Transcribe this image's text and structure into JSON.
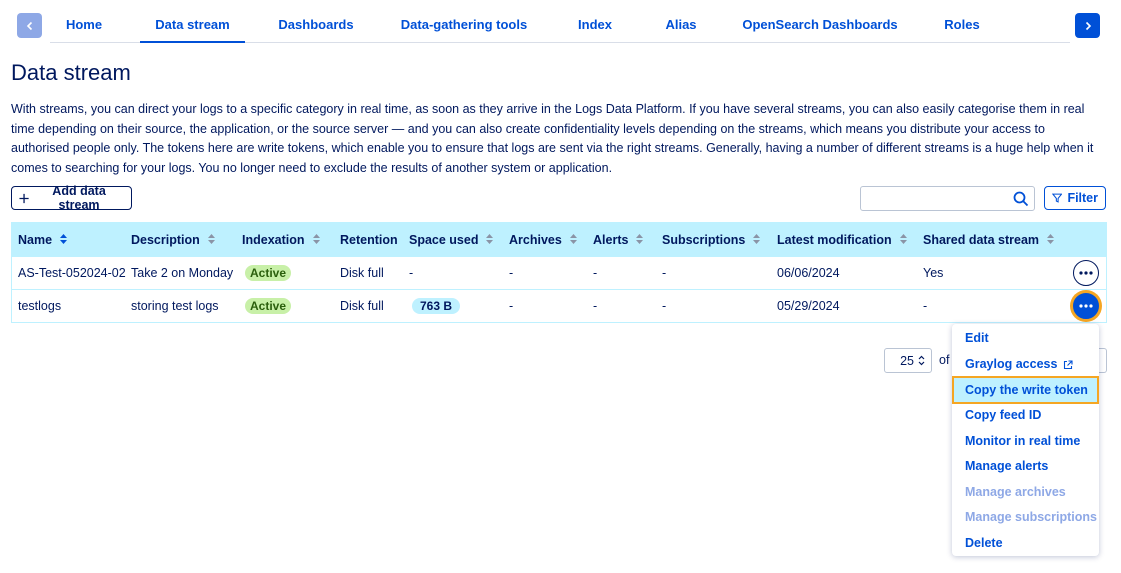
{
  "nav": {
    "tabs": [
      "Home",
      "Data stream",
      "Dashboards",
      "Data-gathering tools",
      "Index",
      "Alias",
      "OpenSearch Dashboards",
      "Roles"
    ],
    "active": "Data stream"
  },
  "page": {
    "title": "Data stream",
    "intro": "With streams, you can direct your logs to a specific category in real time, as soon as they arrive in the Logs Data Platform. If you have several streams, you can also easily categorise them in real time depending on their source, the application, or the source server — and you can also create confidentiality levels depending on the streams, which means you distribute your access to authorised people only. The tokens here are write tokens, which enable you to ensure that logs are sent via the right streams. Generally, having a number of different streams is a huge help when it comes to searching for your logs. You no longer need to exclude the results of another system or application."
  },
  "toolbar": {
    "add_label": "Add data stream",
    "filter_label": "Filter",
    "search_placeholder": ""
  },
  "table": {
    "headers": [
      "Name",
      "Description",
      "Indexation",
      "Retention",
      "Space used",
      "Archives",
      "Alerts",
      "Subscriptions",
      "Latest modification",
      "Shared data stream"
    ],
    "rows": [
      {
        "name": "AS-Test-052024-02",
        "description": "Take 2 on Monday",
        "indexation": "Active",
        "retention": "Disk full",
        "space": "-",
        "archives": "-",
        "alerts": "-",
        "subscriptions": "-",
        "modified": "06/06/2024",
        "shared": "Yes"
      },
      {
        "name": "testlogs",
        "description": "storing test logs",
        "indexation": "Active",
        "retention": "Disk full",
        "space": "763 B",
        "archives": "-",
        "alerts": "-",
        "subscriptions": "-",
        "modified": "05/29/2024",
        "shared": "-"
      }
    ]
  },
  "pagination": {
    "page_size": "25",
    "of_label": "of"
  },
  "menu": {
    "items": [
      "Edit",
      "Graylog access",
      "Copy the write token",
      "Copy feed ID",
      "Monitor in real time",
      "Manage alerts",
      "Manage archives",
      "Manage subscriptions",
      "Delete"
    ],
    "highlighted": "Copy the write token",
    "disabled": [
      "Manage archives",
      "Manage subscriptions"
    ]
  },
  "colors": {
    "primary": "#0050d7",
    "text": "#00185e",
    "header_bg": "#bef1ff",
    "active_badge": "#c8f0a8",
    "highlight_border": "#f5a623"
  }
}
